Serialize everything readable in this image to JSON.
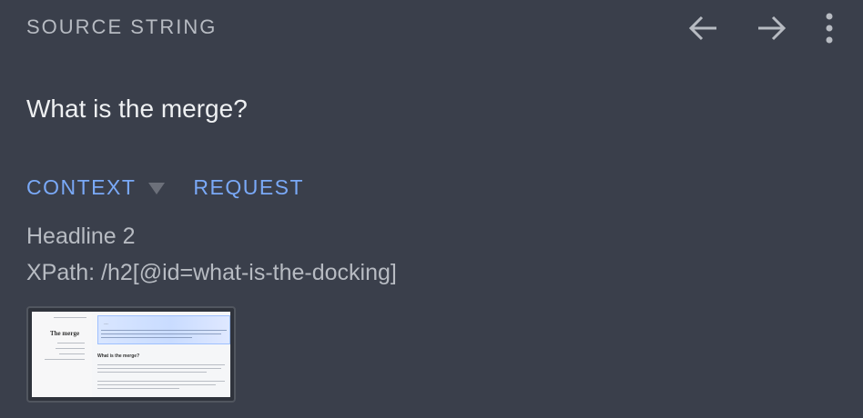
{
  "header": {
    "title": "SOURCE STRING",
    "icons": [
      "arrow-left-icon",
      "arrow-right-icon",
      "more-vert-icon"
    ]
  },
  "source": {
    "text": "What is the merge?"
  },
  "tabs": [
    {
      "label": "CONTEXT",
      "active": true,
      "has_dropdown": true
    },
    {
      "label": "REQUEST",
      "active": false,
      "has_dropdown": false
    }
  ],
  "context": {
    "line1": "Headline 2",
    "line2": "XPath: /h2[@id=what-is-the-docking]"
  },
  "screenshot_thumbnail": {
    "heading": "The merge",
    "callout_title": "…",
    "subhead": "What is the merge?"
  },
  "colors": {
    "background": "#3a3f4b",
    "accent": "#7aa9f7",
    "text_primary": "#eef0f2",
    "text_secondary": "#b7bbc2"
  }
}
